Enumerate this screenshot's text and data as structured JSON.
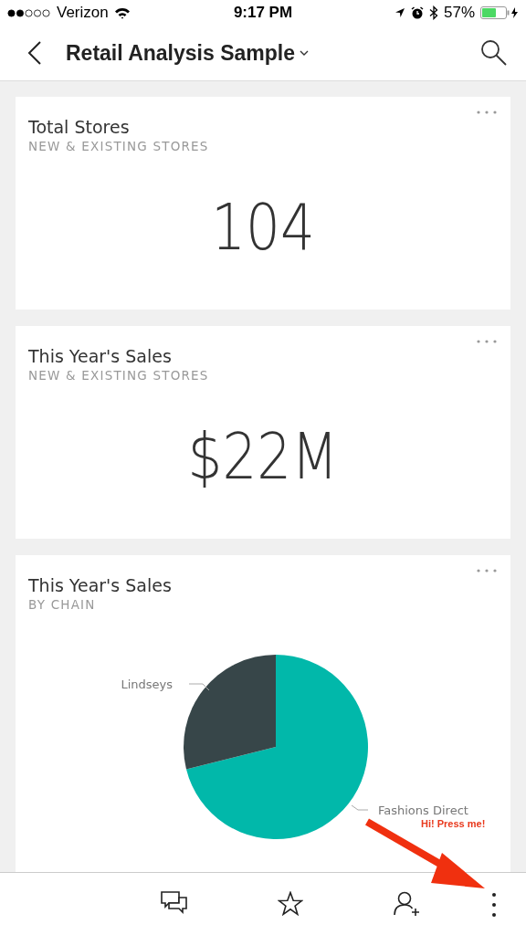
{
  "status_bar": {
    "carrier": "Verizon",
    "time": "9:17 PM",
    "battery": "57%"
  },
  "header": {
    "title": "Retail Analysis Sample"
  },
  "tiles": [
    {
      "kind": "number",
      "title": "Total Stores",
      "subtitle": "NEW & EXISTING STORES",
      "value": "104"
    },
    {
      "kind": "number",
      "title": "This Year's Sales",
      "subtitle": "NEW & EXISTING STORES",
      "value": "$22M"
    },
    {
      "kind": "pie",
      "title": "This Year's Sales",
      "subtitle": "BY CHAIN",
      "labels": [
        "Lindseys",
        "Fashions Direct"
      ]
    }
  ],
  "annotation": {
    "text": "Hi! Press me!"
  }
}
